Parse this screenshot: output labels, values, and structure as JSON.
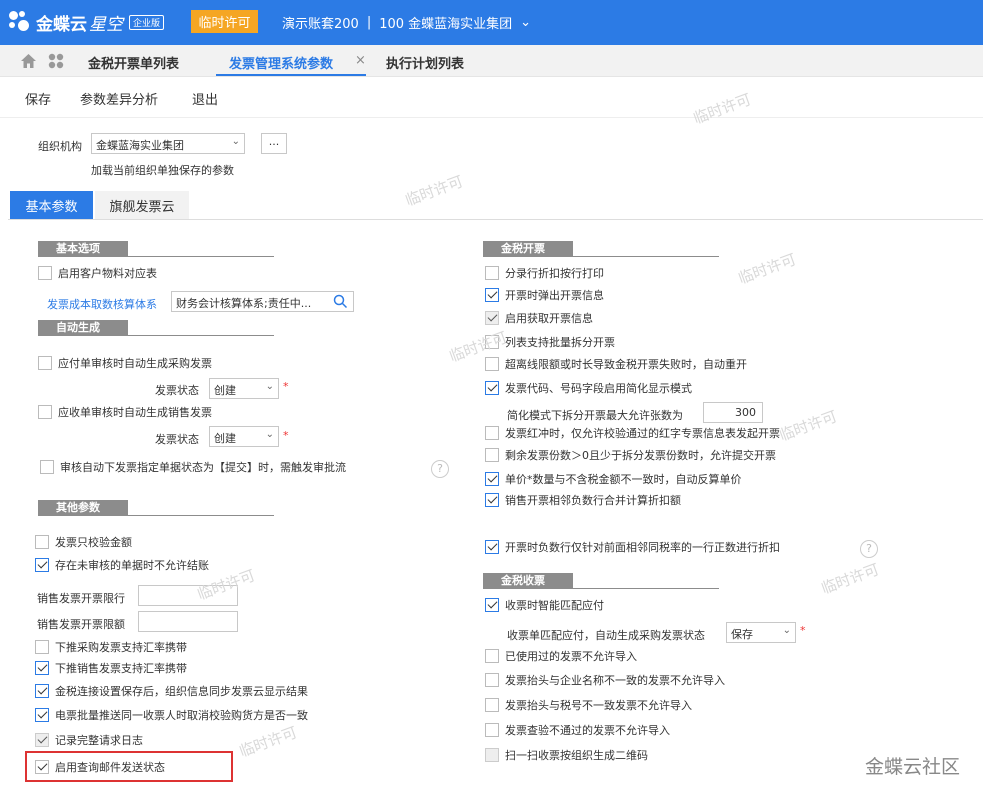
{
  "app": {
    "name": "金蝶云",
    "name2": "星空",
    "edition": "企业版",
    "temp_license": "临时许可",
    "account": "演示账套200",
    "org": "100 金蝶蓝海实业集团"
  },
  "tabs": [
    "金税开票单列表",
    "发票管理系统参数",
    "执行计划列表"
  ],
  "toolbar": {
    "save": "保存",
    "diff": "参数差异分析",
    "exit": "退出"
  },
  "org": {
    "label": "组织机构",
    "value": "金蝶蓝海实业集团",
    "hint": "加载当前组织单独保存的参数",
    "more": "..."
  },
  "param_tabs": [
    "基本参数",
    "旗舰发票云"
  ],
  "left": {
    "sec_basic": "基本选项",
    "cust_material": "启用客户物料对应表",
    "cost_link": "发票成本取数核算体系",
    "cost_value": "财务会计核算体系;责任中...",
    "sec_auto": "自动生成",
    "ap_auto": "应付单审核时自动生成采购发票",
    "status_label": "发票状态",
    "status_value": "创建",
    "ar_auto": "应收单审核时自动生成销售发票",
    "audit_submit": "审核自动下发票指定单据状态为【提交】时，需触发审批流",
    "sec_other": "其他参数",
    "only_amount": "发票只校验金额",
    "unaudited": "存在未审核的单据时不允许结账",
    "sale_limit_row": "销售发票开票限行",
    "sale_limit_amt": "销售发票开票限额",
    "push_purchase": "下推采购发票支持汇率携带",
    "push_sale": "下推销售发票支持汇率携带",
    "sync_cloud": "金税连接设置保存后，组织信息同步发票云显示结果",
    "batch_push": "电票批量推送同一收票人时取消校验购货方是否一致",
    "log": "记录完整请求日志",
    "mail_status": "启用查询邮件发送状态"
  },
  "right": {
    "sec_tax": "金税开票",
    "split_print": "分录行折扣按行打印",
    "popup": "开票时弹出开票信息",
    "get_info": "启用获取开票信息",
    "list_split": "列表支持批量拆分开票",
    "timeout": "超离线限额或时长导致金税开票失败时，自动重开",
    "code_simple": "发票代码、号码字段启用简化显示模式",
    "max_label": "简化模式下拆分开票最大允许张数为",
    "max_value": "300",
    "red_flush": "发票红冲时，仅允许校验通过的红字专票信息表发起开票",
    "remain": "剩余发票份数＞0且少于拆分发票份数时，允许提交开票",
    "unit_price": "单价*数量与不含税金额不一致时，自动反算单价",
    "discount": "销售开票相邻负数行合并计算折扣额",
    "neg_row": "开票时负数行仅针对前面相邻同税率的一行正数进行折扣",
    "sec_receive": "金税收票",
    "match_ap": "收票时智能匹配应付",
    "match_label": "收票单匹配应付，自动生成采购发票状态",
    "match_value": "保存",
    "used": "已使用过的发票不允许导入",
    "title_mismatch": "发票抬头与企业名称不一致的发票不允许导入",
    "tax_mismatch": "发票抬头与税号不一致发票不允许导入",
    "check_fail": "发票查验不通过的发票不允许导入",
    "qr": "扫一扫收票按组织生成二维码"
  },
  "watermark": "临时许可",
  "footer_brand": "金蝶云社区",
  "colors": {
    "primary": "#2c7be5",
    "license": "#f5a623",
    "highlight": "#d33333"
  }
}
